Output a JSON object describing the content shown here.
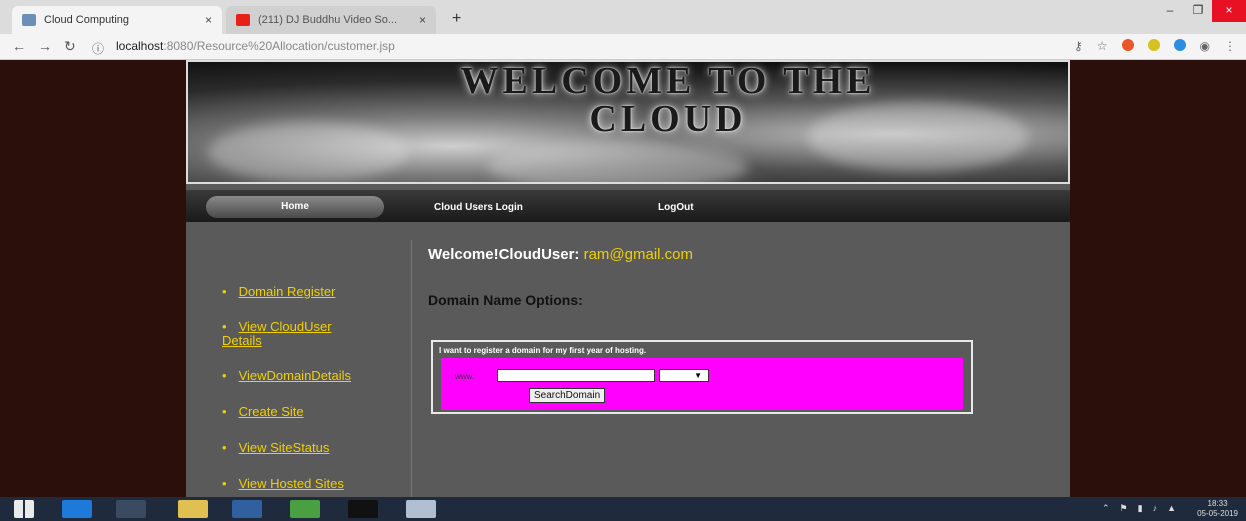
{
  "browser": {
    "tabs": [
      {
        "title": "Cloud Computing",
        "active": true
      },
      {
        "title": "(211) DJ Buddhu Video So...",
        "active": false
      }
    ],
    "close_glyph": "×",
    "new_tab_glyph": "+",
    "url_host": "localhost",
    "url_path": ":8080/Resource%20Allocation/customer.jsp",
    "win_minimize": "–",
    "win_restore": "❐",
    "win_close": "×"
  },
  "banner": {
    "title_line1": "WELCOME TO THE",
    "title_line2": "CLOUD"
  },
  "nav": {
    "home": "Home",
    "cloud_users_login": "Cloud Users Login",
    "logout": "LogOut"
  },
  "sidebar": {
    "items": [
      {
        "label": "Domain Register"
      },
      {
        "label": "View CloudUser Details"
      },
      {
        "label": "ViewDomainDetails"
      },
      {
        "label": "Create Site"
      },
      {
        "label": "View SiteStatus"
      },
      {
        "label": "View Hosted Sites"
      }
    ]
  },
  "main": {
    "welcome_prefix": "Welcome!CloudUser:",
    "user_email": "ram@gmail.com",
    "options_title": "Domain Name Options:",
    "domain_caption": "I want to register a domain for my first year of hosting.",
    "www_label": "www.",
    "domain_value": "",
    "tld_selected": "",
    "search_button": "SearchDomain"
  },
  "taskbar": {
    "time": "18:33",
    "date": "05-05-2019"
  },
  "colors": {
    "page_bg": "#2a0f0a",
    "content_bg": "#5a5a5a",
    "link": "#f0d000",
    "domain_panel": "#ff00ff"
  }
}
